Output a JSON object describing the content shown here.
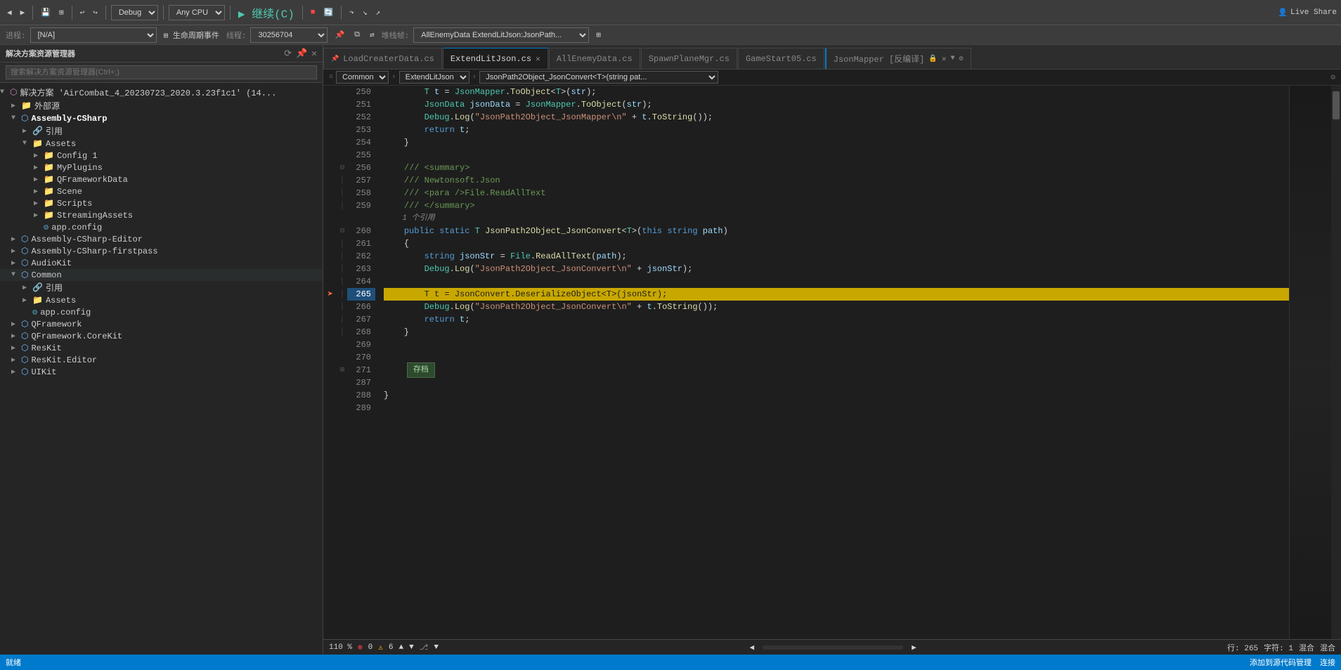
{
  "toolbar": {
    "debug_label": "Debug",
    "cpu_label": "Any CPU",
    "continue_label": "继续(C)",
    "live_share_label": "Live Share",
    "process_label": "进程:",
    "process_value": "[N/A]",
    "lifecycle_label": "生命周期事件",
    "thread_label": "线程:",
    "thread_value": "30256704",
    "stack_label": "堆栈帧:",
    "stack_value": "AllEnemyData ExtendLitJson:JsonPath..."
  },
  "sidebar": {
    "title": "解决方案资源管理器",
    "search_placeholder": "搜索解决方案资源管理器(Ctrl+;)",
    "solution_label": "解决方案 'AirCombat_4_20230723_2020.3.23f1c1' (14...",
    "items": [
      {
        "label": "外部源",
        "type": "folder",
        "level": 1,
        "expanded": false
      },
      {
        "label": "Assembly-CSharp",
        "type": "assembly",
        "level": 1,
        "expanded": true,
        "bold": true
      },
      {
        "label": "引用",
        "type": "ref",
        "level": 2,
        "expanded": false
      },
      {
        "label": "Assets",
        "type": "folder",
        "level": 2,
        "expanded": true
      },
      {
        "label": "Config 1",
        "type": "folder",
        "level": 3,
        "expanded": false
      },
      {
        "label": "MyPlugins",
        "type": "folder",
        "level": 3,
        "expanded": false
      },
      {
        "label": "QFrameworkData",
        "type": "folder",
        "level": 3,
        "expanded": false
      },
      {
        "label": "Scene",
        "type": "folder",
        "level": 3,
        "expanded": false
      },
      {
        "label": "Scripts",
        "type": "folder",
        "level": 3,
        "expanded": false
      },
      {
        "label": "StreamingAssets",
        "type": "folder",
        "level": 3,
        "expanded": false
      },
      {
        "label": "app.config",
        "type": "config",
        "level": 3
      },
      {
        "label": "Assembly-CSharp-Editor",
        "type": "assembly",
        "level": 1,
        "expanded": false
      },
      {
        "label": "Assembly-CSharp-firstpass",
        "type": "assembly",
        "level": 1,
        "expanded": false
      },
      {
        "label": "AudioKit",
        "type": "assembly",
        "level": 1,
        "expanded": false
      },
      {
        "label": "Common",
        "type": "assembly",
        "level": 1,
        "expanded": true,
        "bold": false
      },
      {
        "label": "引用",
        "type": "ref",
        "level": 2,
        "expanded": false
      },
      {
        "label": "Assets",
        "type": "folder",
        "level": 2,
        "expanded": false
      },
      {
        "label": "app.config",
        "type": "config",
        "level": 2
      },
      {
        "label": "QFramework",
        "type": "assembly",
        "level": 1,
        "expanded": false
      },
      {
        "label": "QFramework.CoreKit",
        "type": "assembly",
        "level": 1,
        "expanded": false
      },
      {
        "label": "ResKit",
        "type": "assembly",
        "level": 1,
        "expanded": false
      },
      {
        "label": "ResKit.Editor",
        "type": "assembly",
        "level": 1,
        "expanded": false
      },
      {
        "label": "UIKit",
        "type": "assembly",
        "level": 1,
        "expanded": false
      }
    ]
  },
  "tabs": [
    {
      "label": "LoadCreaterData.cs",
      "active": false,
      "pinned": true,
      "closeable": false
    },
    {
      "label": "ExtendLitJson.cs",
      "active": true,
      "pinned": false,
      "closeable": true
    },
    {
      "label": "AllEnemyData.cs",
      "active": false,
      "pinned": false,
      "closeable": false
    },
    {
      "label": "SpawnPlaneMgr.cs",
      "active": false,
      "pinned": false,
      "closeable": false
    },
    {
      "label": "GameStart05.cs",
      "active": false,
      "pinned": false,
      "closeable": false
    },
    {
      "label": "JsonMapper [反编译]",
      "active": false,
      "pinned": false,
      "closeable": true,
      "locked": true
    }
  ],
  "breadcrumb": {
    "left": "Common",
    "middle": "ExtendLitJson",
    "right": "JsonPath2Object_JsonConvert<T>(string pat..."
  },
  "code": {
    "lines": [
      {
        "num": 250,
        "content": "        T t = JsonMapper.ToObject<T>(str);",
        "type": "normal"
      },
      {
        "num": 251,
        "content": "        JsonData jsonData = JsonMapper.ToObject(str);",
        "type": "normal"
      },
      {
        "num": 252,
        "content": "        Debug.Log(“JsonPath2Object_JsonMapper\\n” + t.ToString());",
        "type": "normal"
      },
      {
        "num": 253,
        "content": "        return t;",
        "type": "normal"
      },
      {
        "num": 254,
        "content": "    }",
        "type": "normal"
      },
      {
        "num": 255,
        "content": "",
        "type": "normal"
      },
      {
        "num": 256,
        "content": "    /// <summary>",
        "type": "comment",
        "fold": true
      },
      {
        "num": 257,
        "content": "    /// Newtonsoft.Json",
        "type": "comment"
      },
      {
        "num": 258,
        "content": "    /// <para />File.ReadAllText",
        "type": "comment"
      },
      {
        "num": 259,
        "content": "    /// </summary>",
        "type": "comment"
      },
      {
        "num": "ref",
        "content": "1 个引用",
        "type": "ref"
      },
      {
        "num": 260,
        "content": "    public static T JsonPath2Object_JsonConvert<T>(this string path)",
        "type": "normal",
        "fold": true
      },
      {
        "num": 261,
        "content": "    {",
        "type": "normal"
      },
      {
        "num": 262,
        "content": "        string jsonStr = File.ReadAllText(path);",
        "type": "normal"
      },
      {
        "num": 263,
        "content": "        Debug.Log(“JsonPath2Object_JsonConvert\\n” + jsonStr);",
        "type": "normal"
      },
      {
        "num": 264,
        "content": "",
        "type": "normal"
      },
      {
        "num": 265,
        "content": "        T t = JsonConvert.DeserializeObject<T>(jsonStr);",
        "type": "highlighted",
        "breakpoint": true,
        "bookmark": true
      },
      {
        "num": 266,
        "content": "        Debug.Log(“JsonPath2Object_JsonConvert\\n” + t.ToString());",
        "type": "normal"
      },
      {
        "num": 267,
        "content": "        return t;",
        "type": "normal"
      },
      {
        "num": 268,
        "content": "    }",
        "type": "normal"
      },
      {
        "num": 269,
        "content": "",
        "type": "normal"
      },
      {
        "num": 270,
        "content": "",
        "type": "normal"
      },
      {
        "num": 271,
        "content": "存档",
        "type": "summary_box",
        "fold": true
      },
      {
        "num": 287,
        "content": "",
        "type": "normal"
      },
      {
        "num": 288,
        "content": "}",
        "type": "normal"
      },
      {
        "num": 289,
        "content": "",
        "type": "normal"
      }
    ]
  },
  "status": {
    "ready": "就绪",
    "errors": "0",
    "warnings": "6",
    "zoom": "110 %",
    "line": "行: 265",
    "col": "字符: 1",
    "mixed1": "混合",
    "mixed2": "混合",
    "add_source": "添加到源代码管理",
    "connection": "连接"
  }
}
